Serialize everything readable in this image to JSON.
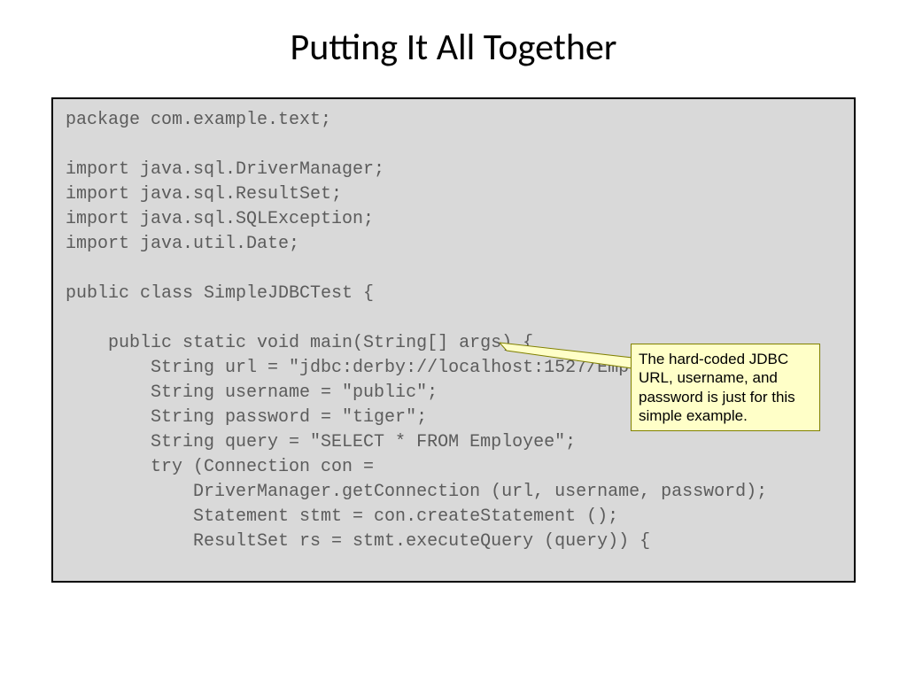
{
  "title": "Putting It All Together",
  "code": "package com.example.text;\n\nimport java.sql.DriverManager;\nimport java.sql.ResultSet;\nimport java.sql.SQLException;\nimport java.util.Date;\n\npublic class SimpleJDBCTest {\n\n    public static void main(String[] args) {\n        String url = \"jdbc:derby://localhost:1527/EmployeeDB\";\n        String username = \"public\";\n        String password = \"tiger\";\n        String query = \"SELECT * FROM Employee\";\n        try (Connection con =\n            DriverManager.getConnection (url, username, password);\n            Statement stmt = con.createStatement ();\n            ResultSet rs = stmt.executeQuery (query)) {",
  "callout": "The hard-coded JDBC URL, username, and password is just for this simple example."
}
